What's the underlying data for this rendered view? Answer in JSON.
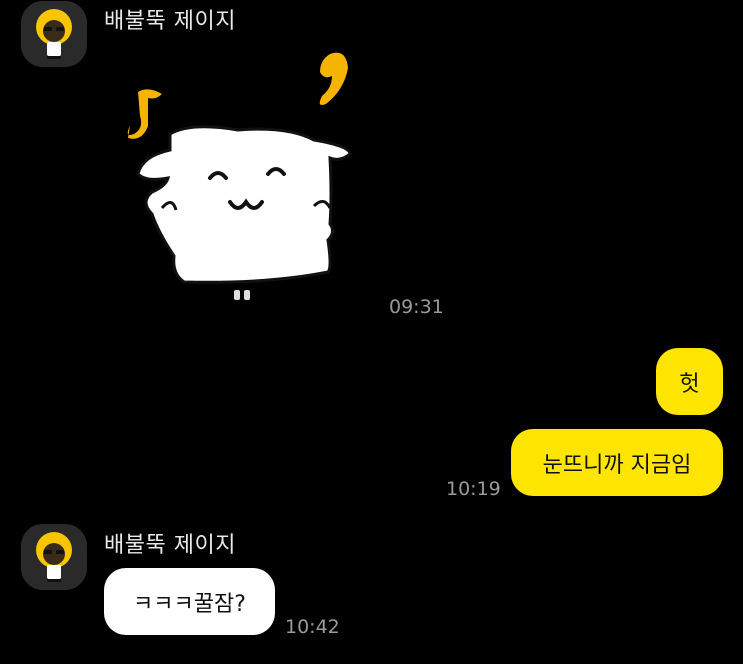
{
  "colors": {
    "background": "#000000",
    "my_bubble": "#fee500",
    "other_bubble": "#ffffff",
    "timestamp": "#9a9a9a"
  },
  "messages": [
    {
      "sender": "배불뚝 제이지",
      "type": "sticker",
      "sticker": "dancing-white-character-sticker",
      "time": "09:31"
    },
    {
      "sender": "me",
      "type": "text",
      "text": "헛",
      "time": ""
    },
    {
      "sender": "me",
      "type": "text",
      "text": "눈뜨니까 지금임",
      "time": "10:19"
    },
    {
      "sender": "배불뚝 제이지",
      "type": "text",
      "text": "ㅋㅋㅋ꿀잠?",
      "time": "10:42"
    }
  ],
  "contact": {
    "name": "배불뚝 제이지",
    "avatar": "jay-g-avatar-icon"
  }
}
